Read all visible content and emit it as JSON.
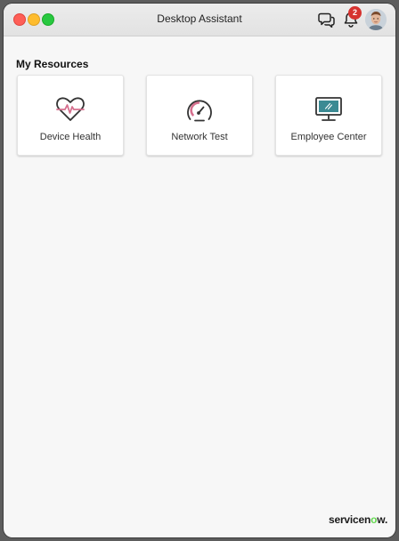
{
  "window": {
    "title": "Desktop Assistant"
  },
  "header": {
    "chat_icon": "chat-bubbles-icon",
    "notifications_icon": "bell-icon",
    "notifications_count": "2",
    "avatar_icon": "user-avatar"
  },
  "section": {
    "title": "My Resources"
  },
  "resources": [
    {
      "label": "Device Health",
      "icon": "heart-pulse-icon"
    },
    {
      "label": "Network Test",
      "icon": "speedometer-icon"
    },
    {
      "label": "Employee Center",
      "icon": "monitor-icon"
    }
  ],
  "footer": {
    "brand_prefix": "servicen",
    "brand_o": "o",
    "brand_suffix": "w."
  },
  "colors": {
    "badge": "#d6322f",
    "accent_pink": "#d6708f",
    "accent_teal": "#3b8a93",
    "brand_green": "#62d84e"
  }
}
